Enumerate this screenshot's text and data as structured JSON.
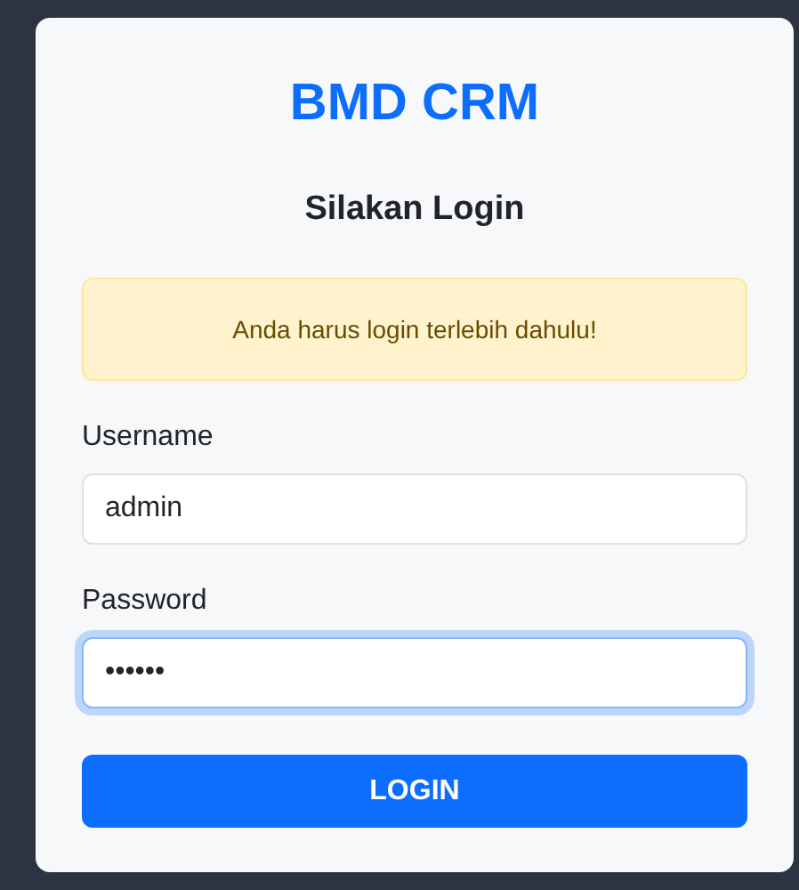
{
  "title": "BMD CRM",
  "subtitle": "Silakan Login",
  "alert": {
    "text": "Anda harus login terlebih dahulu!"
  },
  "fields": [
    {
      "label": "Username",
      "value": "admin",
      "focused": false
    },
    {
      "label": "Password",
      "value": "••••••",
      "focused": true
    }
  ],
  "button": "LOGIN"
}
